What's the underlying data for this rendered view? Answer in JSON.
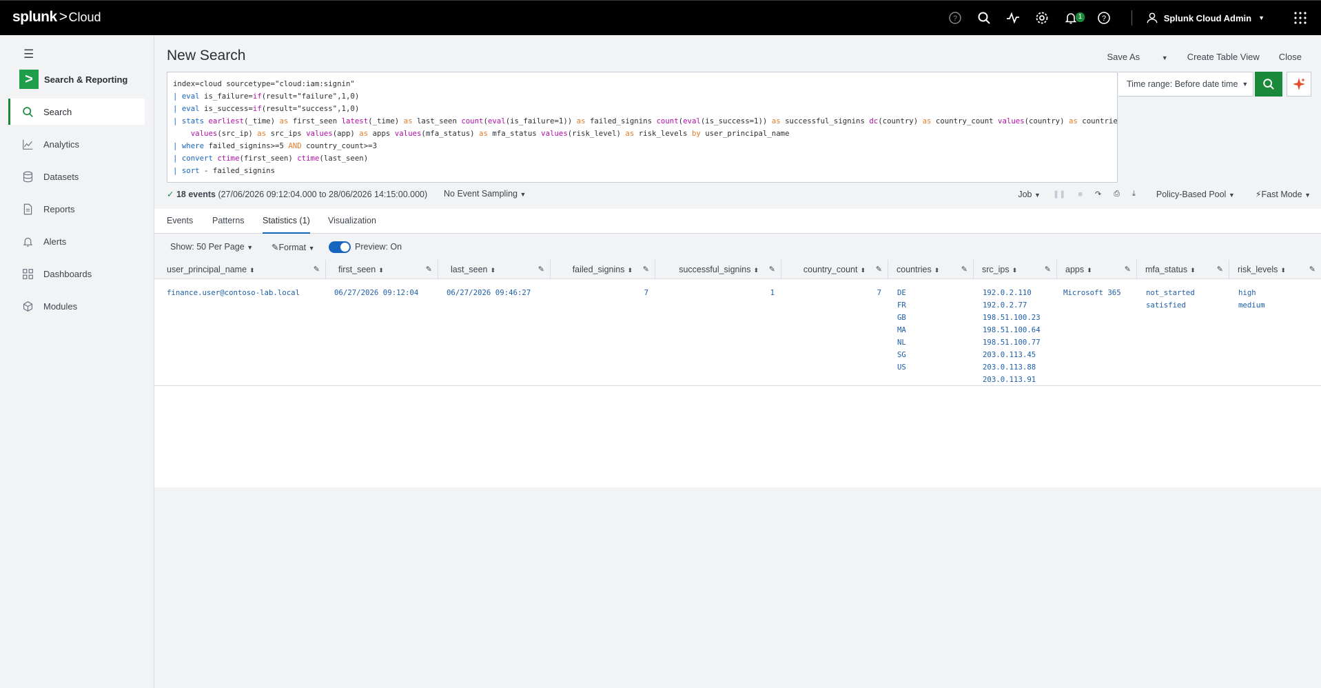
{
  "topbar": {
    "brand_splunk": "splunk",
    "brand_gt": ">",
    "brand_cloud": "Cloud",
    "notification_count": "1",
    "user_name": "Splunk Cloud Admin"
  },
  "sidebar": {
    "app_name": "Search & Reporting",
    "items": [
      {
        "label": "Search",
        "icon": "search-icon"
      },
      {
        "label": "Analytics",
        "icon": "analytics-icon"
      },
      {
        "label": "Datasets",
        "icon": "datasets-icon"
      },
      {
        "label": "Reports",
        "icon": "reports-icon"
      },
      {
        "label": "Alerts",
        "icon": "bell-icon"
      },
      {
        "label": "Dashboards",
        "icon": "dashboards-icon"
      },
      {
        "label": "Modules",
        "icon": "modules-icon"
      }
    ]
  },
  "page": {
    "title": "New Search",
    "save_as": "Save As",
    "create_table_view": "Create Table View",
    "close": "Close"
  },
  "query": {
    "lines": [
      "index=cloud sourcetype=\"cloud:iam:signin\"",
      "| eval is_failure=if(result=\"failure\",1,0)",
      "| eval is_success=if(result=\"success\",1,0)",
      "| stats earliest(_time) as first_seen latest(_time) as last_seen count(eval(is_failure=1)) as failed_signins count(eval(is_success=1)) as successful_signins dc(country) as country_count values(country) as countries",
      "    values(src_ip) as src_ips values(app) as apps values(mfa_status) as mfa_status values(risk_level) as risk_levels by user_principal_name",
      "| where failed_signins>=5 AND country_count>=3",
      "| convert ctime(first_seen) ctime(last_seen)",
      "| sort - failed_signins"
    ]
  },
  "timerange": {
    "label": "Time range: Before date time"
  },
  "status": {
    "check": "✓",
    "events": "18 events",
    "range": "(27/06/2026 09:12:04.000 to 28/06/2026 14:15:00.000)",
    "sampling": "No Event Sampling",
    "job": "Job",
    "pool": "Policy-Based Pool",
    "mode": "Fast Mode"
  },
  "tabs": [
    "Events",
    "Patterns",
    "Statistics (1)",
    "Visualization"
  ],
  "toolbar": {
    "per_page": "Show: 50 Per Page",
    "format": "Format",
    "preview": "Preview: On"
  },
  "table": {
    "columns": [
      "user_principal_name",
      "first_seen",
      "last_seen",
      "failed_signins",
      "successful_signins",
      "country_count",
      "countries",
      "src_ips",
      "apps",
      "mfa_status",
      "risk_levels"
    ],
    "row": {
      "user_principal_name": "finance.user@contoso-lab.local",
      "first_seen": "06/27/2026 09:12:04",
      "last_seen": "06/27/2026 09:46:27",
      "failed_signins": "7",
      "successful_signins": "1",
      "country_count": "7",
      "countries": [
        "DE",
        "FR",
        "GB",
        "MA",
        "NL",
        "SG",
        "US"
      ],
      "src_ips": [
        "192.0.2.110",
        "192.0.2.77",
        "198.51.100.23",
        "198.51.100.64",
        "198.51.100.77",
        "203.0.113.45",
        "203.0.113.88",
        "203.0.113.91"
      ],
      "apps": [
        "Microsoft 365"
      ],
      "mfa_status": [
        "not_started",
        "satisfied"
      ],
      "risk_levels": [
        "high",
        "medium"
      ]
    }
  }
}
